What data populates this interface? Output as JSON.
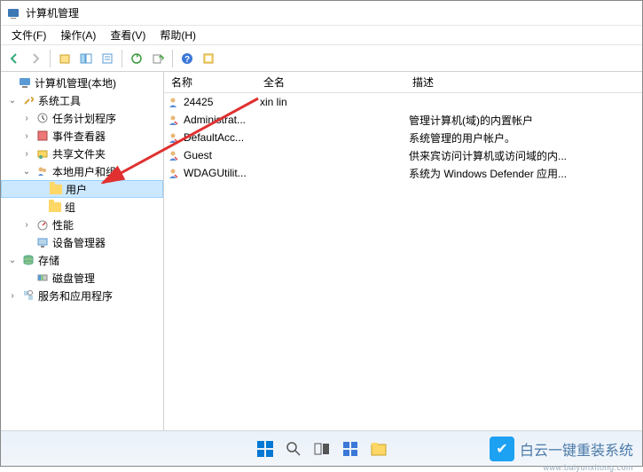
{
  "window": {
    "title": "计算机管理"
  },
  "menu": {
    "file": "文件(F)",
    "action": "操作(A)",
    "view": "查看(V)",
    "help": "帮助(H)"
  },
  "toolbar": {
    "back": "back",
    "forward": "forward",
    "up": "up",
    "show_hide": "show-hide-tree",
    "properties": "properties",
    "refresh": "refresh",
    "export": "export",
    "help": "help"
  },
  "tree": {
    "root": "计算机管理(本地)",
    "system_tools": "系统工具",
    "task_scheduler": "任务计划程序",
    "event_viewer": "事件查看器",
    "shared_folders": "共享文件夹",
    "local_users": "本地用户和组",
    "users": "用户",
    "groups": "组",
    "performance": "性能",
    "device_manager": "设备管理器",
    "storage": "存储",
    "disk_management": "磁盘管理",
    "services_apps": "服务和应用程序"
  },
  "list": {
    "headers": {
      "name": "名称",
      "fullname": "全名",
      "description": "描述"
    },
    "rows": [
      {
        "name": "24425",
        "fullname": "xin lin",
        "description": ""
      },
      {
        "name": "Administrat...",
        "fullname": "",
        "description": "管理计算机(域)的内置帐户"
      },
      {
        "name": "DefaultAcc...",
        "fullname": "",
        "description": "系统管理的用户帐户。"
      },
      {
        "name": "Guest",
        "fullname": "",
        "description": "供来宾访问计算机或访问域的内..."
      },
      {
        "name": "WDAGUtilit...",
        "fullname": "",
        "description": "系统为 Windows Defender 应用..."
      }
    ]
  },
  "watermark": {
    "brand": "白云一键重装系统",
    "url": "www.baiyunxitong.com"
  }
}
